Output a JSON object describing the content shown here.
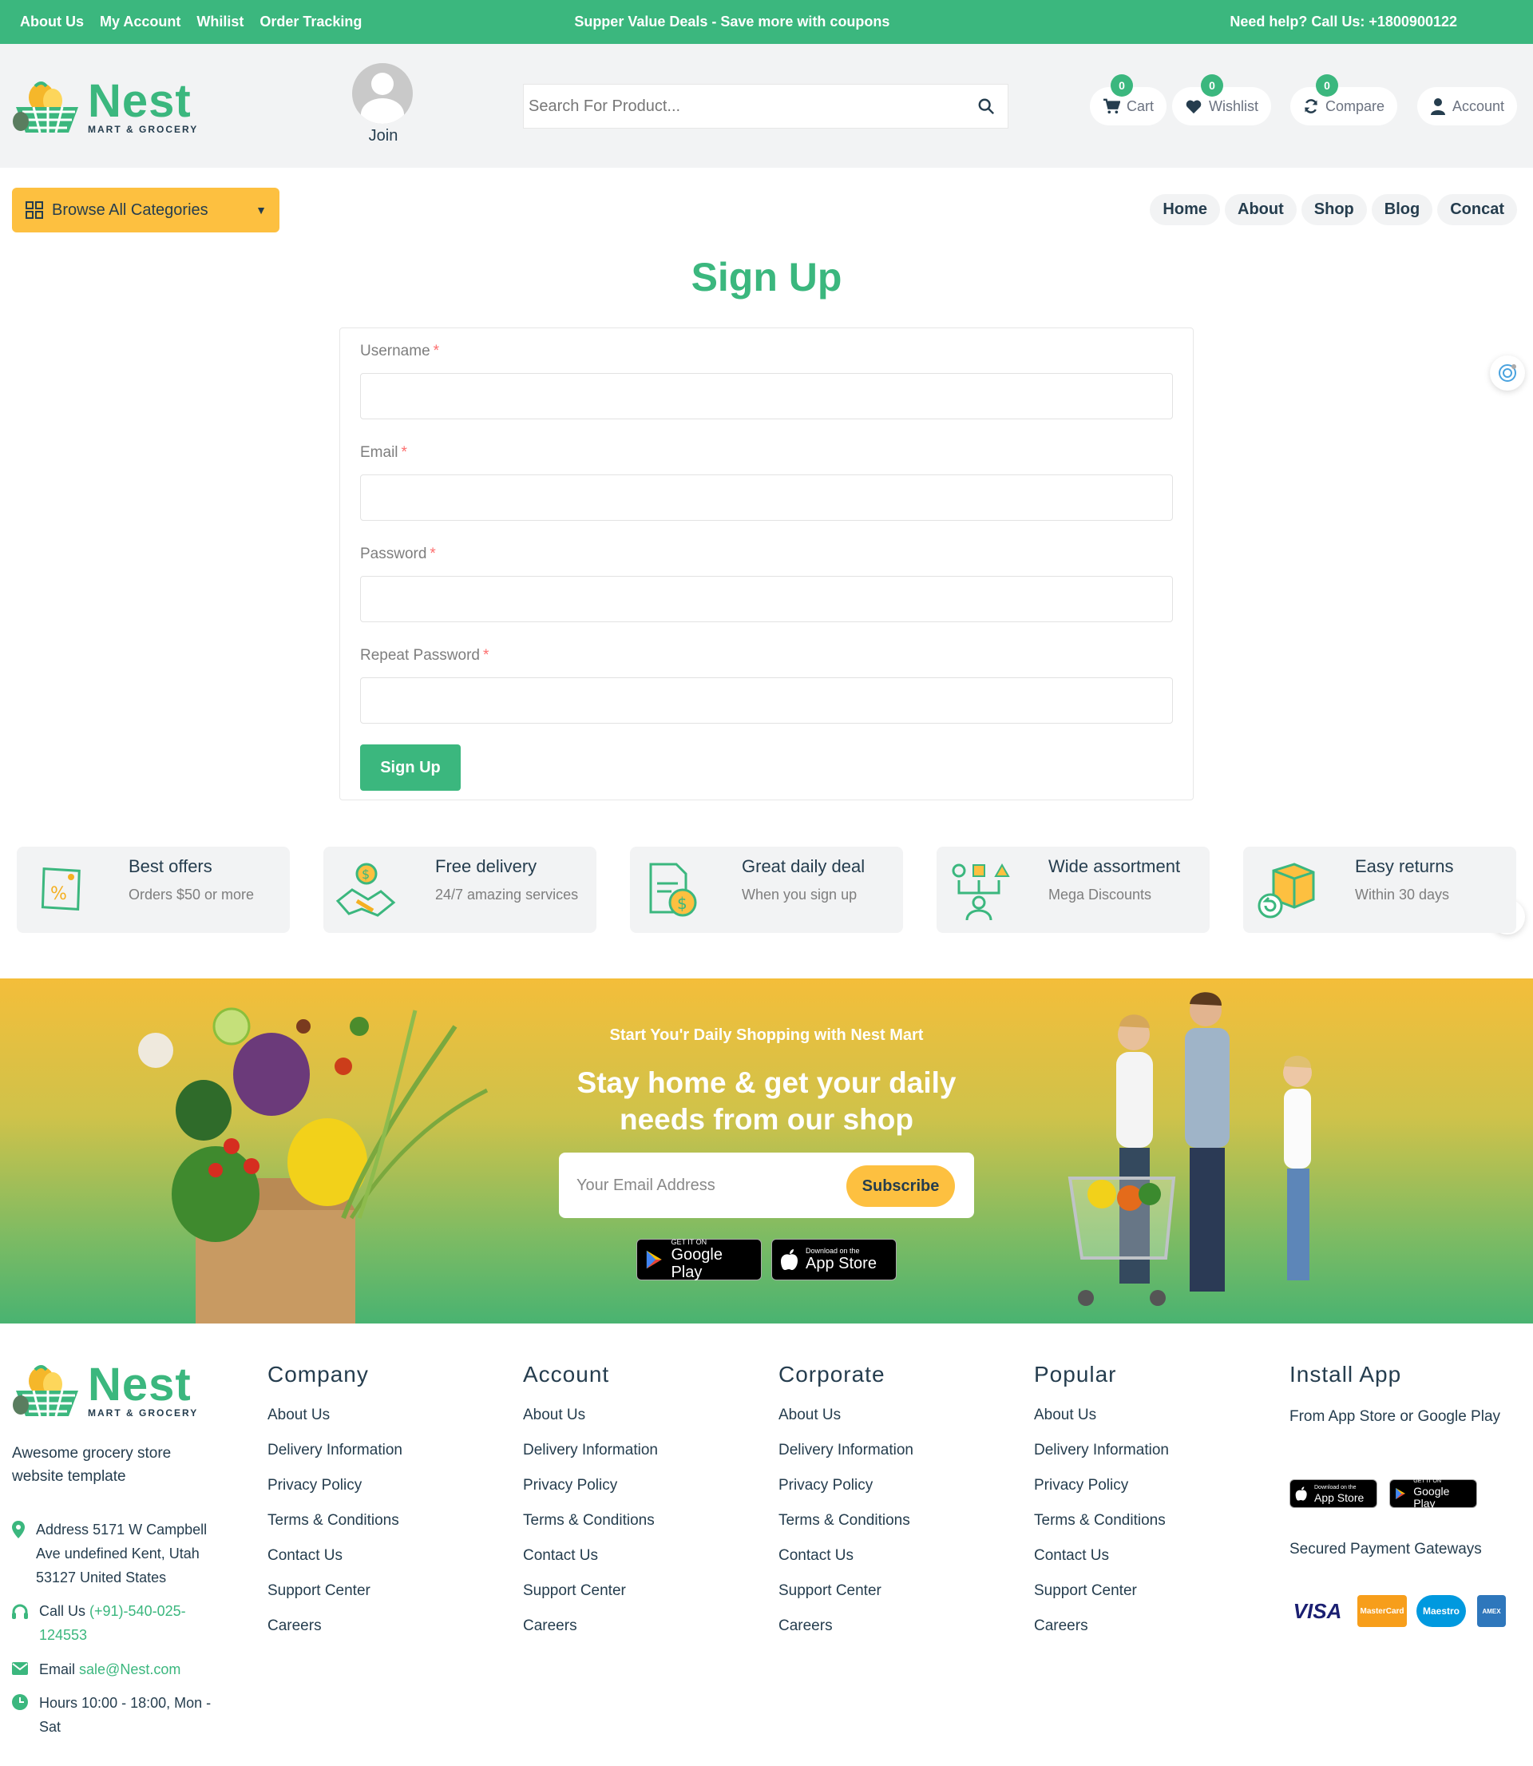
{
  "topbar": {
    "links": [
      "About Us",
      "My Account",
      "Whilist",
      "Order Tracking"
    ],
    "promo": "Supper Value Deals - Save more with coupons",
    "help": "Need help? Call Us: +1800900122"
  },
  "logo": {
    "brand": "Nest",
    "tagline": "MART & GROCERY"
  },
  "header": {
    "join_label": "Join",
    "search_placeholder": "Search For Product...",
    "cart": {
      "label": "Cart",
      "count": "0"
    },
    "wishlist": {
      "label": "Wishlist",
      "count": "0"
    },
    "compare": {
      "label": "Compare",
      "count": "0"
    },
    "account": {
      "label": "Account"
    }
  },
  "nav": {
    "browse_label": "Browse All Categories",
    "items": [
      "Home",
      "About",
      "Shop",
      "Blog",
      "Concat"
    ]
  },
  "signup": {
    "title": "Sign Up",
    "fields": [
      {
        "label": "Username",
        "value": ""
      },
      {
        "label": "Email",
        "value": ""
      },
      {
        "label": "Password",
        "value": ""
      },
      {
        "label": "Repeat Password",
        "value": ""
      }
    ],
    "required_mark": "*",
    "submit_label": "Sign Up"
  },
  "features": [
    {
      "title": "Best offers",
      "subtitle": "Orders $50 or more",
      "icon": "price-tag-icon"
    },
    {
      "title": "Free delivery",
      "subtitle": "24/7 amazing services",
      "icon": "handshake-icon"
    },
    {
      "title": "Great daily deal",
      "subtitle": "When you sign up",
      "icon": "invoice-dollar-icon"
    },
    {
      "title": "Wide assortment",
      "subtitle": "Mega Discounts",
      "icon": "assortment-icon"
    },
    {
      "title": "Easy returns",
      "subtitle": "Within 30 days",
      "icon": "return-box-icon"
    }
  ],
  "newsletter": {
    "subtitle": "Start You'r Daily Shopping with Nest Mart",
    "title_line1": "Stay home & get your daily",
    "title_line2": "needs from our shop",
    "email_placeholder": "Your Email Address",
    "subscribe_label": "Subscribe",
    "google_small": "GET IT ON",
    "google_big": "Google Play",
    "apple_small": "Download on the",
    "apple_big": "App Store"
  },
  "footer": {
    "description": "Awesome grocery store website template",
    "address_label": "Address",
    "address": "5171 W Campbell Ave undefined Kent, Utah 53127 United States",
    "call_label": "Call Us",
    "phone": "(+91)-540-025-124553",
    "email_label": "Email",
    "email": "sale@Nest.com",
    "hours_label": "Hours",
    "hours": "10:00 - 18:00, Mon - Sat",
    "columns": [
      {
        "title": "Company",
        "links": [
          "About Us",
          "Delivery Information",
          "Privacy Policy",
          "Terms & Conditions",
          "Contact Us",
          "Support Center",
          "Careers"
        ]
      },
      {
        "title": "Account",
        "links": [
          "About Us",
          "Delivery Information",
          "Privacy Policy",
          "Terms & Conditions",
          "Contact Us",
          "Support Center",
          "Careers"
        ]
      },
      {
        "title": "Corporate",
        "links": [
          "About Us",
          "Delivery Information",
          "Privacy Policy",
          "Terms & Conditions",
          "Contact Us",
          "Support Center",
          "Careers"
        ]
      },
      {
        "title": "Popular",
        "links": [
          "About Us",
          "Delivery Information",
          "Privacy Policy",
          "Terms & Conditions",
          "Contact Us",
          "Support Center",
          "Careers"
        ]
      }
    ],
    "install": {
      "title": "Install App",
      "text": "From App Store or Google Play",
      "apple_small": "Download on the",
      "apple_big": "App Store",
      "google_small": "GET IT ON",
      "google_big": "Google Play",
      "payments_label": "Secured Payment Gateways",
      "payments": [
        "VISA",
        "MasterCard",
        "Maestro",
        "AMEX"
      ]
    }
  },
  "colors": {
    "brand": "#3bb77e",
    "accent": "#fdc040",
    "text": "#253d4e",
    "muted": "#7e7e7e"
  }
}
